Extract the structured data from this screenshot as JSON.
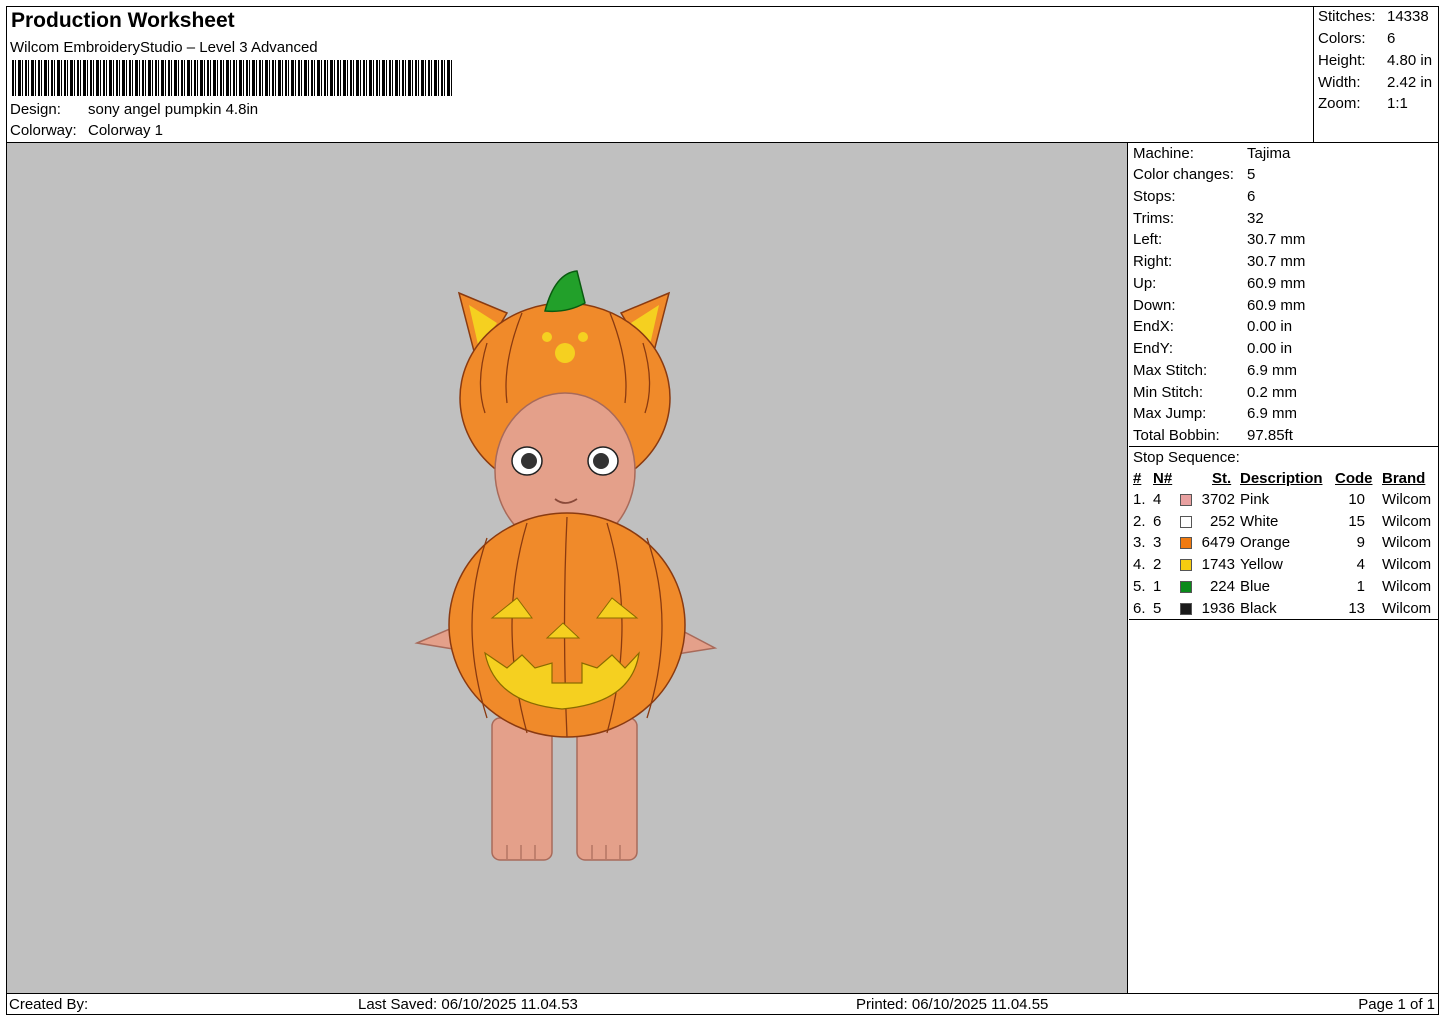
{
  "header": {
    "title": "Production Worksheet",
    "software": "Wilcom EmbroideryStudio – Level 3 Advanced",
    "design_label": "Design:",
    "design_value": "sony angel pumpkin 4.8in",
    "colorway_label": "Colorway:",
    "colorway_value": "Colorway 1"
  },
  "stats": {
    "stitches_label": "Stitches:",
    "stitches_value": "14338",
    "colors_label": "Colors:",
    "colors_value": "6",
    "height_label": "Height:",
    "height_value": "4.80 in",
    "width_label": "Width:",
    "width_value": "2.42 in",
    "zoom_label": "Zoom:",
    "zoom_value": "1:1"
  },
  "info": {
    "machine_label": "Machine:",
    "machine_value": "Tajima",
    "color_changes_label": "Color changes:",
    "color_changes_value": "5",
    "stops_label": "Stops:",
    "stops_value": "6",
    "trims_label": "Trims:",
    "trims_value": "32",
    "left_label": "Left:",
    "left_value": "30.7 mm",
    "right_label": "Right:",
    "right_value": "30.7 mm",
    "up_label": "Up:",
    "up_value": "60.9 mm",
    "down_label": "Down:",
    "down_value": "60.9 mm",
    "endx_label": "EndX:",
    "endx_value": "0.00 in",
    "endy_label": "EndY:",
    "endy_value": "0.00 in",
    "max_stitch_label": "Max Stitch:",
    "max_stitch_value": "6.9 mm",
    "min_stitch_label": "Min Stitch:",
    "min_stitch_value": "0.2 mm",
    "max_jump_label": "Max Jump:",
    "max_jump_value": "6.9 mm",
    "total_bobbin_label": "Total Bobbin:",
    "total_bobbin_value": "97.85ft"
  },
  "stop_sequence": {
    "title": "Stop Sequence:",
    "headers": {
      "idx": "#",
      "num": "N#",
      "st": "St.",
      "desc": "Description",
      "code": "Code",
      "brand": "Brand"
    },
    "rows": [
      {
        "idx": "1.",
        "num": "4",
        "color": "#e8a0a0",
        "st": "3702",
        "desc": "Pink",
        "code": "10",
        "brand": "Wilcom"
      },
      {
        "idx": "2.",
        "num": "6",
        "color": "#ffffff",
        "st": "252",
        "desc": "White",
        "code": "15",
        "brand": "Wilcom"
      },
      {
        "idx": "3.",
        "num": "3",
        "color": "#f07a10",
        "st": "6479",
        "desc": "Orange",
        "code": "9",
        "brand": "Wilcom"
      },
      {
        "idx": "4.",
        "num": "2",
        "color": "#f5cc10",
        "st": "1743",
        "desc": "Yellow",
        "code": "4",
        "brand": "Wilcom"
      },
      {
        "idx": "5.",
        "num": "1",
        "color": "#0a8a1a",
        "st": "224",
        "desc": "Blue",
        "code": "1",
        "brand": "Wilcom"
      },
      {
        "idx": "6.",
        "num": "5",
        "color": "#1a1a1a",
        "st": "1936",
        "desc": "Black",
        "code": "13",
        "brand": "Wilcom"
      }
    ]
  },
  "footer": {
    "created_by": "Created By:",
    "last_saved": "Last Saved: 06/10/2025 11.04.53",
    "printed": "Printed: 06/10/2025 11.04.55",
    "page": "Page 1 of 1"
  }
}
